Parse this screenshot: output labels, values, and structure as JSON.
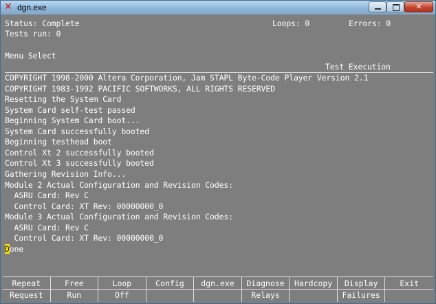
{
  "window": {
    "title": "dgn.exe"
  },
  "header": {
    "status": "Status: Complete",
    "loops": "Loops: 0",
    "errors": "Errors: 0",
    "tests_run": "Tests run: 0",
    "menu_select": "Menu Select",
    "mode_label": "Test Execution"
  },
  "console_lines": [
    "COPYRIGHT 1998-2000 Altera Corporation, Jam STAPL Byte-Code Player Version 2.1",
    "COPYRIGHT 1983-1992 PACIFIC SOFTWORKS, ALL RIGHTS RESERVED",
    "Resetting the System Card",
    "System Card self-test passed",
    "Beginning System Card boot...",
    "System Card successfully booted",
    "Beginning testhead boot",
    "Control Xt 2 successfully booted",
    "Control Xt 3 successfully booted",
    "Gathering Revision Info...",
    "Module 2 Actual Configuration and Revision Codes:",
    "  ASRU Card: Rev C",
    "  Control Card: XT Rev: 00000000_0",
    "Module 3 Actual Configuration and Revision Codes:",
    "  ASRU Card: Rev C",
    "  Control Card: XT Rev: 00000000_0"
  ],
  "prompt": {
    "cursor_char": "D",
    "rest": "one"
  },
  "function_keys": [
    {
      "line1": "Repeat",
      "line2": "Request"
    },
    {
      "line1": "Free",
      "line2": "Run"
    },
    {
      "line1": "Loop",
      "line2": "Off"
    },
    {
      "line1": "Config",
      "line2": ""
    },
    {
      "line1": "dgn.exe",
      "line2": ""
    },
    {
      "line1": "Diagnose",
      "line2": "Relays"
    },
    {
      "line1": "Hardcopy",
      "line2": ""
    },
    {
      "line1": "Display",
      "line2": "Failures"
    },
    {
      "line1": "Exit",
      "line2": ""
    }
  ],
  "colors": {
    "background": "#7e7e7e",
    "text": "#ffffff",
    "cursor": "#f5e000",
    "titlebar": "#8fb6d8"
  }
}
